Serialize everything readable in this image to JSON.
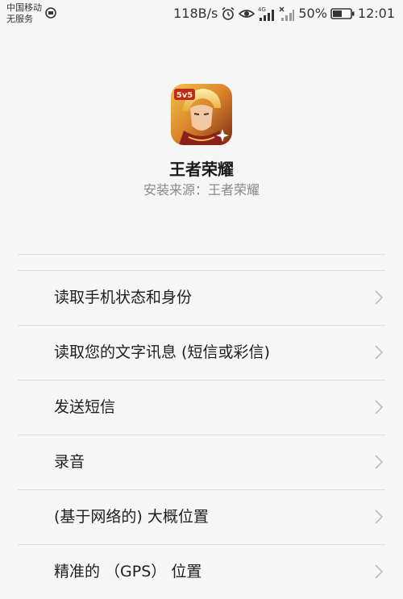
{
  "status_bar": {
    "carrier_line1": "中国移动",
    "carrier_line2": "无服务",
    "speed": "118B/s",
    "network": "4G",
    "battery": "50%",
    "time": "12:01",
    "icons": [
      "carrier-status-icon",
      "alarm-icon",
      "eye-icon",
      "signal-4g-icon",
      "signal-none-icon",
      "battery-icon"
    ]
  },
  "app": {
    "name": "王者荣耀",
    "install_source": "安装来源：王者荣耀",
    "icon_badge": "5v5"
  },
  "permissions": [
    {
      "label": "读取手机状态和身份"
    },
    {
      "label": "读取您的文字讯息 (短信或彩信)"
    },
    {
      "label": "发送短信"
    },
    {
      "label": "录音"
    },
    {
      "label": "(基于网络的) 大概位置"
    },
    {
      "label": "精准的 （GPS） 位置"
    }
  ]
}
